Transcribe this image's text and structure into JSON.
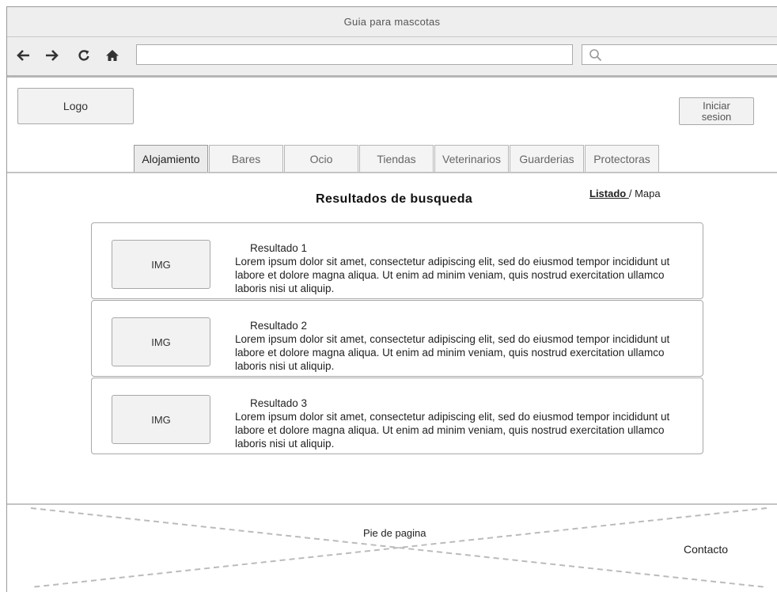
{
  "window": {
    "title": "Guia para mascotas"
  },
  "browser": {
    "back_icon": "arrow-left-icon",
    "forward_icon": "arrow-right-icon",
    "reload_icon": "reload-icon",
    "home_icon": "home-icon",
    "url_value": "",
    "search_value": ""
  },
  "header": {
    "logo": "Logo",
    "login_label": "Iniciar\nsesion"
  },
  "tabs": [
    {
      "label": "Alojamiento",
      "active": true
    },
    {
      "label": "Bares"
    },
    {
      "label": "Ocio"
    },
    {
      "label": "Tiendas"
    },
    {
      "label": "Veterinarios"
    },
    {
      "label": "Guarderias"
    },
    {
      "label": "Protectoras"
    }
  ],
  "main": {
    "title": "Resultados de busqueda",
    "view_list": "Listado ",
    "view_separator": "/ ",
    "view_map": "Mapa",
    "results": [
      {
        "img": "IMG",
        "title": "Resultado 1",
        "text": "Lorem ipsum dolor sit amet, consectetur adipiscing elit, sed do eiusmod tempor incididunt ut labore et dolore magna aliqua. Ut enim ad minim veniam, quis nostrud exercitation ullamco laboris nisi ut aliquip."
      },
      {
        "img": "IMG",
        "title": "Resultado 2",
        "text": "Lorem ipsum dolor sit amet, consectetur adipiscing elit, sed do eiusmod tempor incididunt ut labore et dolore magna aliqua. Ut enim ad minim veniam, quis nostrud exercitation ullamco laboris nisi ut aliquip."
      },
      {
        "img": "IMG",
        "title": "Resultado 3",
        "text": "Lorem ipsum dolor sit amet, consectetur adipiscing elit, sed do eiusmod tempor incididunt ut labore et dolore magna aliqua. Ut enim ad minim veniam, quis nostrud exercitation ullamco laboris nisi ut aliquip."
      }
    ]
  },
  "footer": {
    "label": "Pie de pagina",
    "contact": "Contacto"
  }
}
